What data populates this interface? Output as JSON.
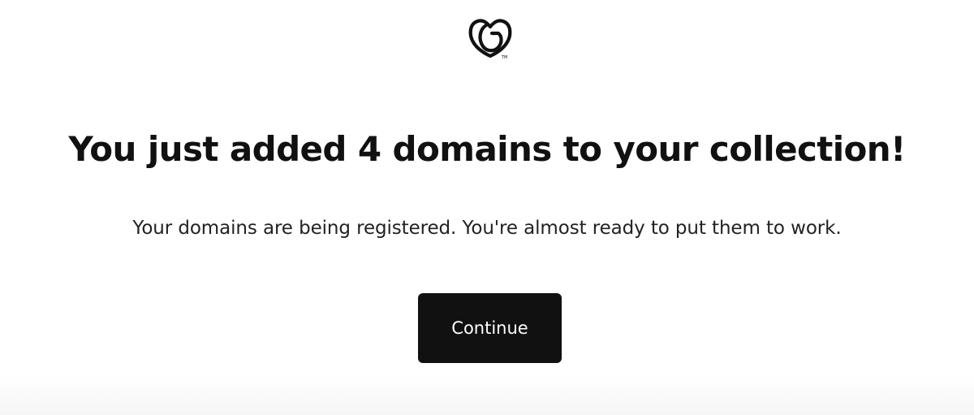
{
  "brand": {
    "logo_icon": "godaddy-heart-logo-icon",
    "logo_color": "#111111"
  },
  "main": {
    "headline": "You just added 4 domains to your collection!",
    "subtext": "Your domains are being registered. You're almost ready to put them to work.",
    "continue_label": "Continue"
  },
  "colors": {
    "text": "#111111",
    "button_bg": "#111111",
    "button_text": "#ffffff",
    "background": "#ffffff"
  }
}
